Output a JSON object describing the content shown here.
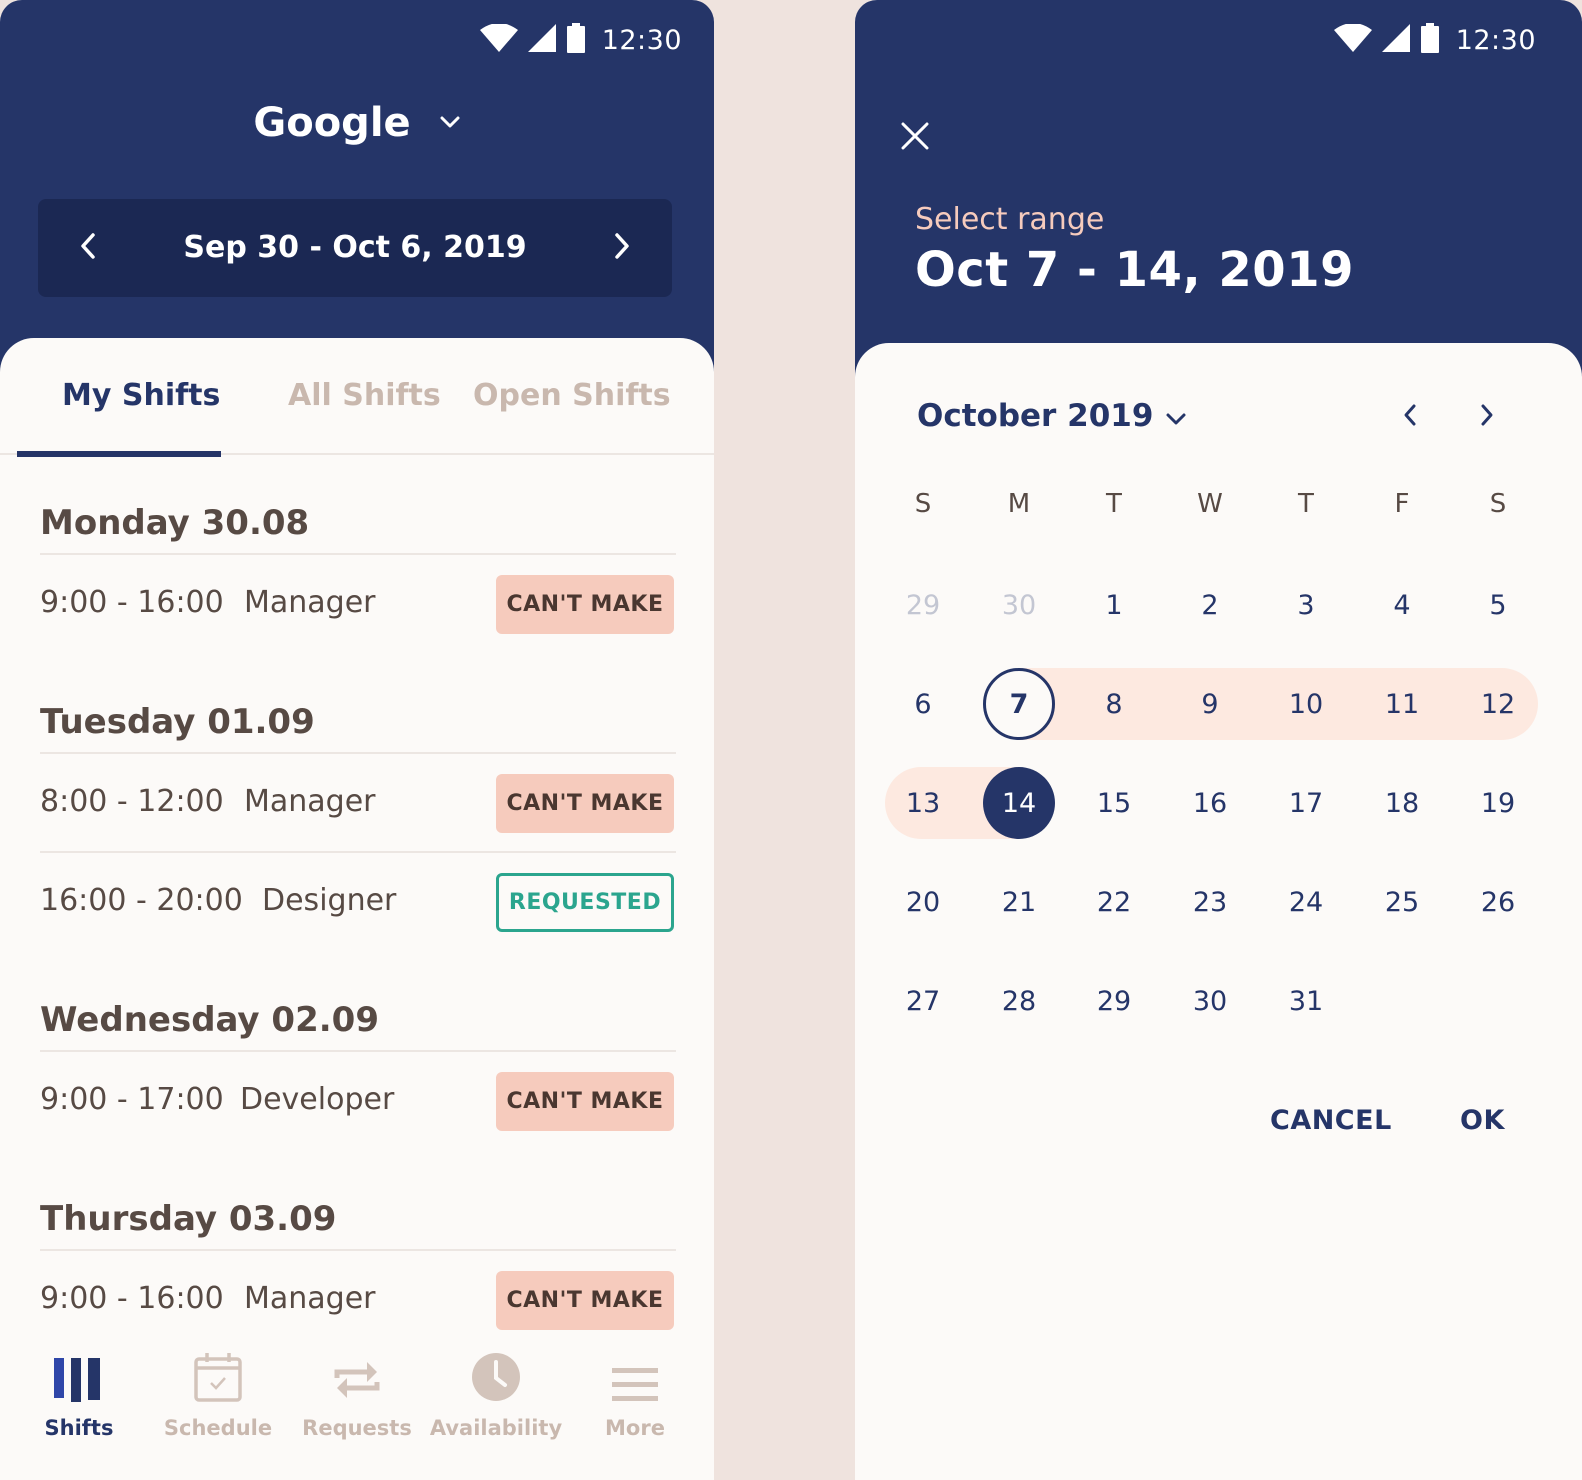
{
  "status_bar": {
    "time": "12:30",
    "icons": [
      "wifi-icon",
      "signal-icon",
      "battery-icon"
    ]
  },
  "left": {
    "org_name": "Google",
    "date_range": "Sep 30 - Oct 6, 2019",
    "tabs": [
      {
        "label": "My Shifts",
        "active": true
      },
      {
        "label": "All Shifts",
        "active": false
      },
      {
        "label": "Open Shifts",
        "active": false
      }
    ],
    "days": [
      {
        "title": "Monday 30.08",
        "shifts": [
          {
            "time": "9:00 - 16:00",
            "role": "Manager",
            "status": "CAN'T MAKE",
            "kind": "cant"
          }
        ]
      },
      {
        "title": "Tuesday 01.09",
        "shifts": [
          {
            "time": "8:00 - 12:00",
            "role": "Manager",
            "status": "CAN'T MAKE",
            "kind": "cant"
          },
          {
            "time": "16:00 - 20:00",
            "role": "Designer",
            "status": "REQUESTED",
            "kind": "req"
          }
        ]
      },
      {
        "title": "Wednesday 02.09",
        "shifts": [
          {
            "time": "9:00 - 17:00",
            "role": "Developer",
            "status": "CAN'T MAKE",
            "kind": "cant"
          }
        ]
      },
      {
        "title": "Thursday 03.09",
        "shifts": [
          {
            "time": "9:00 - 16:00",
            "role": "Manager",
            "status": "CAN'T MAKE",
            "kind": "cant"
          }
        ]
      }
    ],
    "bottom_nav": [
      {
        "label": "Shifts",
        "icon": "shifts-bars-icon",
        "active": true
      },
      {
        "label": "Schedule",
        "icon": "calendar-check-icon",
        "active": false
      },
      {
        "label": "Requests",
        "icon": "swap-arrows-icon",
        "active": false
      },
      {
        "label": "Availability",
        "icon": "clock-icon",
        "active": false
      },
      {
        "label": "More",
        "icon": "menu-icon",
        "active": false
      }
    ]
  },
  "right": {
    "select_label": "Select range",
    "selected_range": "Oct 7 - 14, 2019",
    "month": "October 2019",
    "weekdays": [
      "S",
      "M",
      "T",
      "W",
      "T",
      "F",
      "S"
    ],
    "weeks": [
      [
        "29",
        "30",
        "1",
        "2",
        "3",
        "4",
        "5"
      ],
      [
        "6",
        "7",
        "8",
        "9",
        "10",
        "11",
        "12"
      ],
      [
        "13",
        "14",
        "15",
        "16",
        "17",
        "18",
        "19"
      ],
      [
        "20",
        "21",
        "22",
        "23",
        "24",
        "25",
        "26"
      ],
      [
        "27",
        "28",
        "29",
        "30",
        "31",
        "",
        ""
      ]
    ],
    "range_start": "7",
    "range_end": "14",
    "cancel_label": "CANCEL",
    "ok_label": "OK"
  },
  "colors": {
    "header": "#253568",
    "range_bar": "#1b2853",
    "cant_make": "#f6cbbd",
    "requested": "#2ba58e",
    "range_band": "#fde9e0",
    "muted": "#c9b8ae"
  }
}
